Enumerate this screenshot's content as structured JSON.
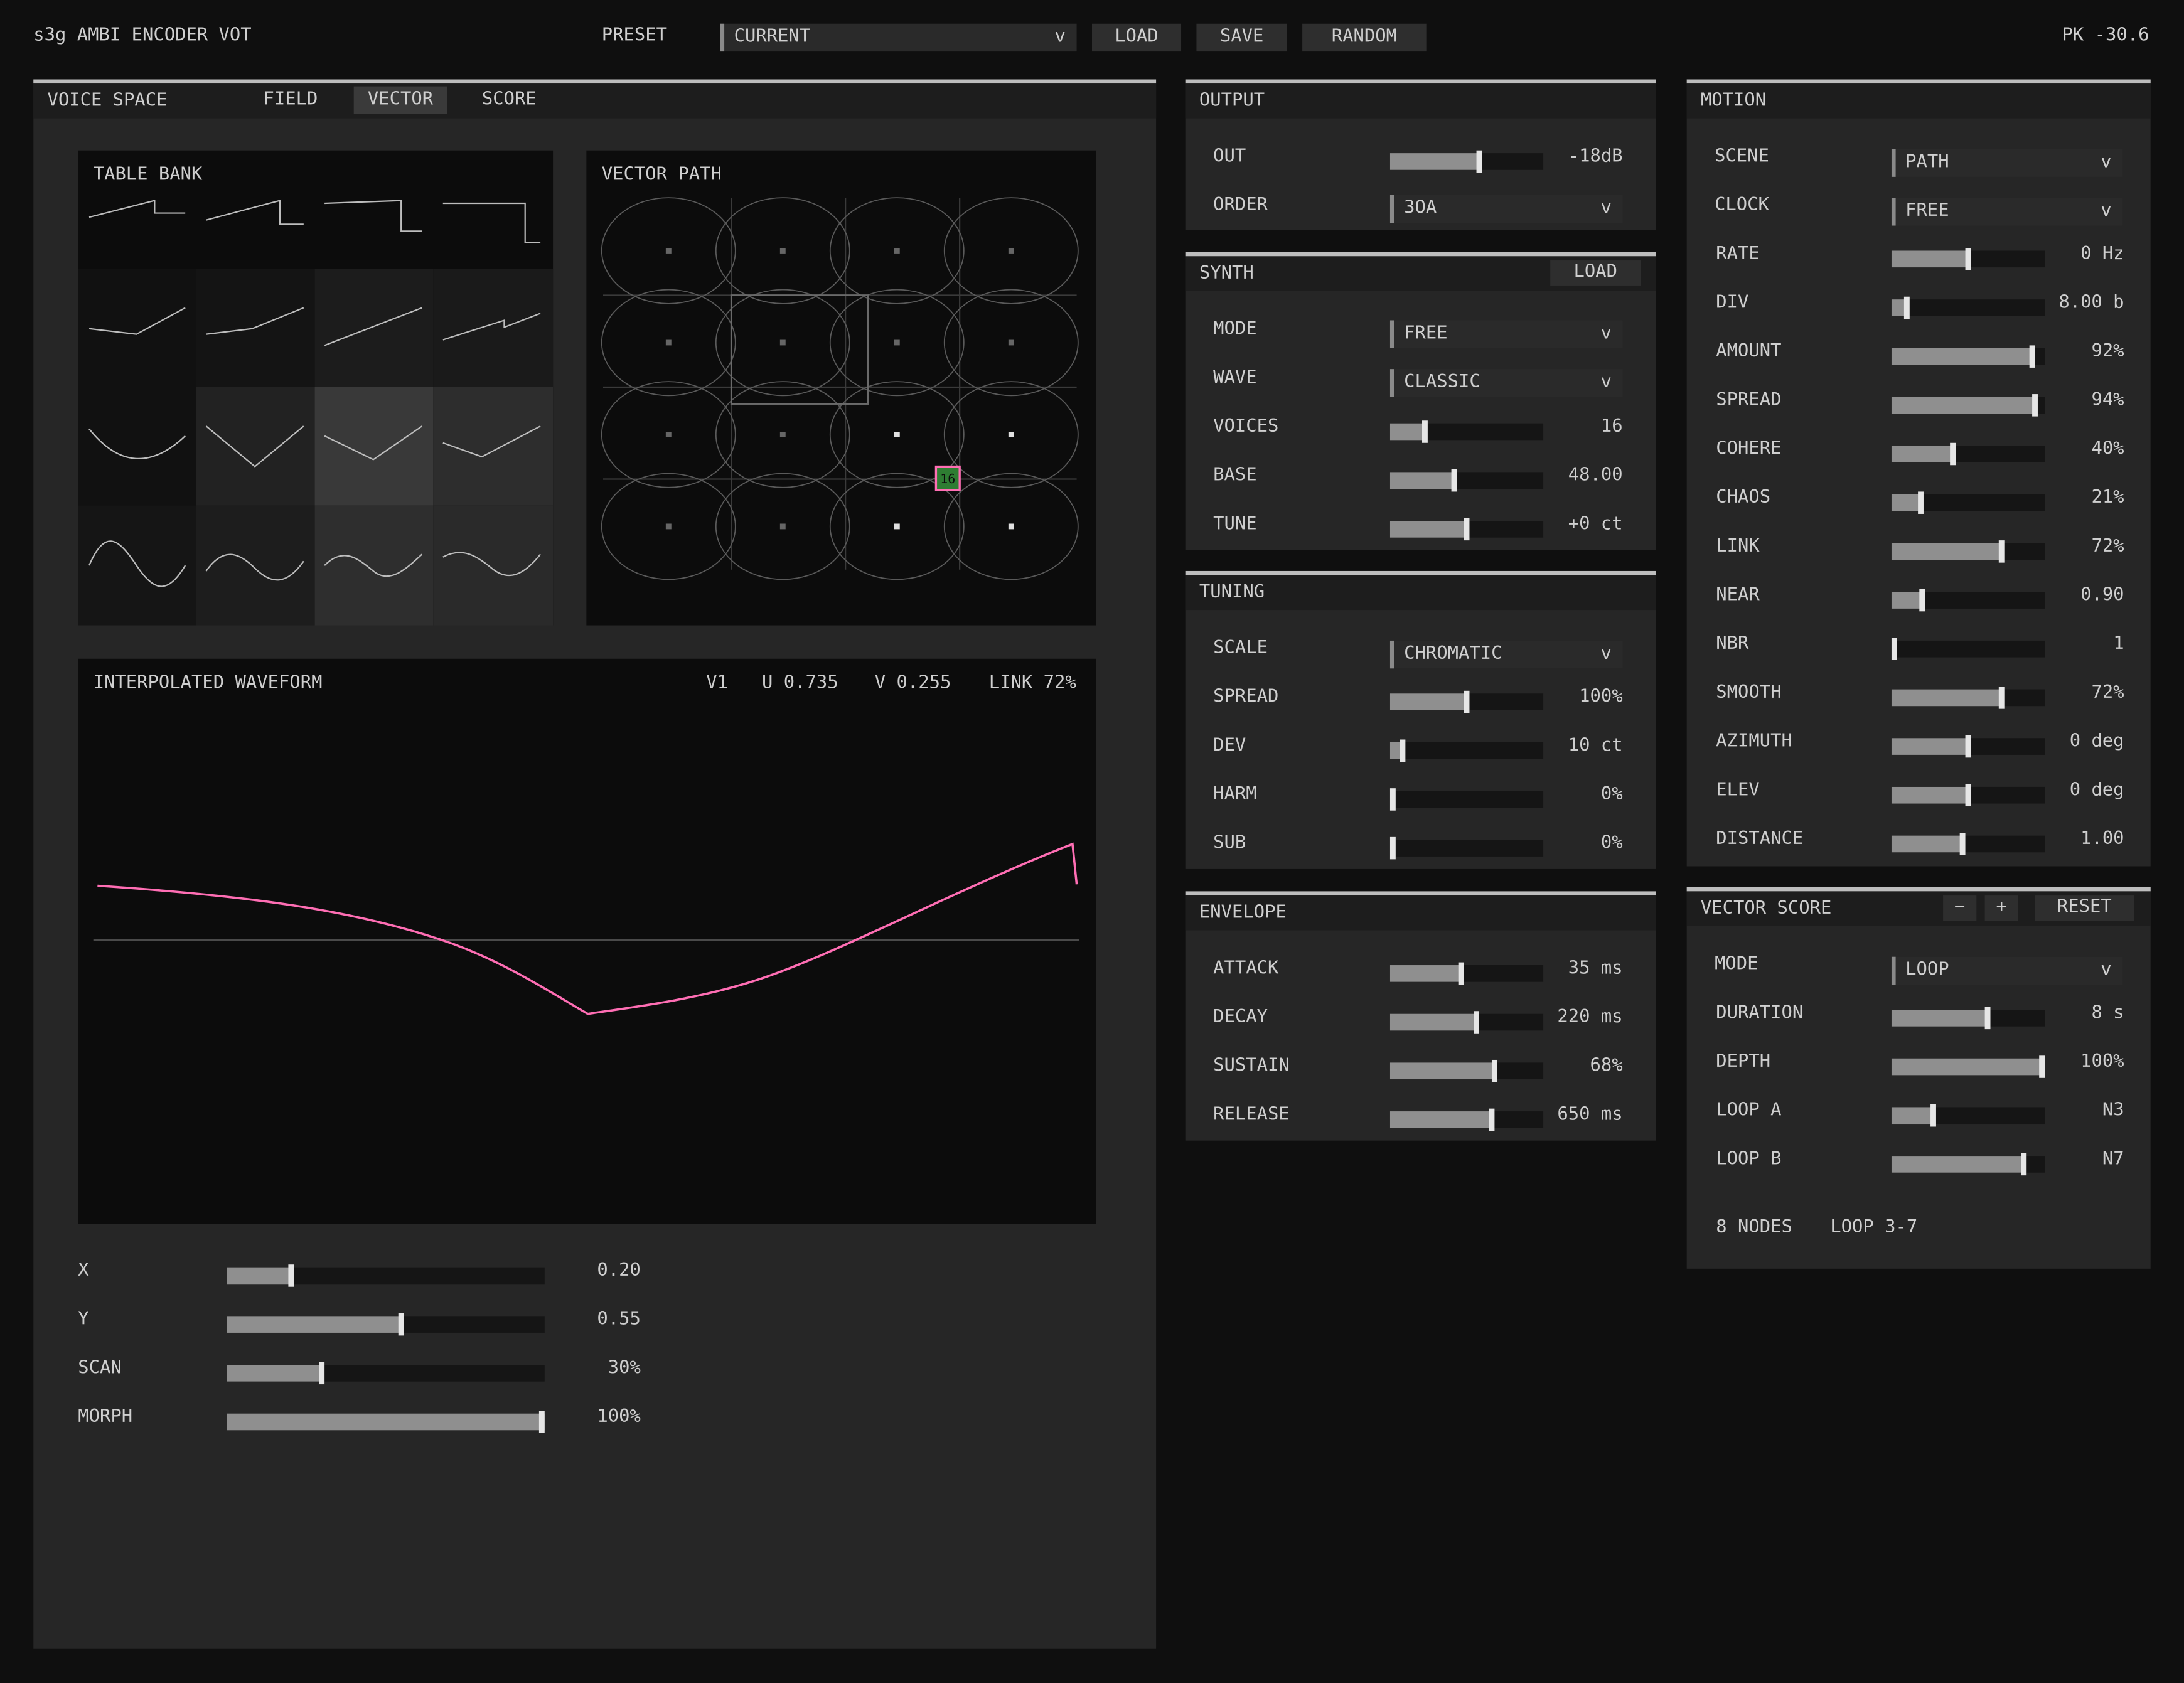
{
  "app": {
    "title": "s3g AMBI ENCODER VOT",
    "peak": "PK -30.6"
  },
  "preset": {
    "label": "PRESET",
    "value": "CURRENT",
    "chevron": "v",
    "load": "LOAD",
    "save": "SAVE",
    "random": "RANDOM"
  },
  "voice_space": {
    "title": "VOICE SPACE",
    "tabs": [
      {
        "label": "FIELD",
        "active": false
      },
      {
        "label": "VECTOR",
        "active": true
      },
      {
        "label": "SCORE",
        "active": false
      }
    ],
    "table_bank": {
      "title": "TABLE BANK"
    },
    "vector_path": {
      "title": "VECTOR PATH",
      "node_label": "16"
    },
    "waveform": {
      "title": "INTERPOLATED WAVEFORM",
      "voice": "V1",
      "u": "U 0.735",
      "v": "V 0.255",
      "link": "LINK 72%"
    },
    "sliders": [
      {
        "label": "X",
        "value": "0.20",
        "level": 0.2
      },
      {
        "label": "Y",
        "value": "0.55",
        "level": 0.55
      },
      {
        "label": "SCAN",
        "value": "30%",
        "level": 0.3
      },
      {
        "label": "MORPH",
        "value": "100%",
        "level": 1.0
      }
    ]
  },
  "output": {
    "title": "OUTPUT",
    "out": {
      "label": "OUT",
      "value": "-18dB",
      "level": 0.58
    },
    "order": {
      "label": "ORDER",
      "value": "3OA",
      "chevron": "v"
    }
  },
  "synth": {
    "title": "SYNTH",
    "load": "LOAD",
    "mode": {
      "label": "MODE",
      "value": "FREE",
      "chevron": "v"
    },
    "wave": {
      "label": "WAVE",
      "value": "CLASSIC",
      "chevron": "v"
    },
    "sliders": [
      {
        "label": "VOICES",
        "value": "16",
        "level": 0.23
      },
      {
        "label": "BASE",
        "value": "48.00",
        "level": 0.42
      },
      {
        "label": "TUNE",
        "value": "+0 ct",
        "level": 0.5
      }
    ]
  },
  "tuning": {
    "title": "TUNING",
    "scale": {
      "label": "SCALE",
      "value": "CHROMATIC",
      "chevron": "v"
    },
    "sliders": [
      {
        "label": "SPREAD",
        "value": "100%",
        "level": 0.5
      },
      {
        "label": "DEV",
        "value": "10 ct",
        "level": 0.08
      },
      {
        "label": "HARM",
        "value": "0%",
        "level": 0.0
      },
      {
        "label": "SUB",
        "value": "0%",
        "level": 0.0
      }
    ]
  },
  "envelope": {
    "title": "ENVELOPE",
    "sliders": [
      {
        "label": "ATTACK",
        "value": "35 ms",
        "level": 0.46
      },
      {
        "label": "DECAY",
        "value": "220 ms",
        "level": 0.56
      },
      {
        "label": "SUSTAIN",
        "value": "68%",
        "level": 0.68
      },
      {
        "label": "RELEASE",
        "value": "650 ms",
        "level": 0.66
      }
    ]
  },
  "motion": {
    "title": "MOTION",
    "scene": {
      "label": "SCENE",
      "value": "PATH",
      "chevron": "v"
    },
    "clock": {
      "label": "CLOCK",
      "value": "FREE",
      "chevron": "v"
    },
    "sliders": [
      {
        "label": "RATE",
        "value": "0 Hz",
        "level": 0.5
      },
      {
        "label": "DIV",
        "value": "8.00 b",
        "level": 0.1
      },
      {
        "label": "AMOUNT",
        "value": "92%",
        "level": 0.92
      },
      {
        "label": "SPREAD",
        "value": "94%",
        "level": 0.94
      },
      {
        "label": "COHERE",
        "value": "40%",
        "level": 0.4
      },
      {
        "label": "CHAOS",
        "value": "21%",
        "level": 0.19
      },
      {
        "label": "LINK",
        "value": "72%",
        "level": 0.72
      },
      {
        "label": "NEAR",
        "value": "0.90",
        "level": 0.2
      },
      {
        "label": "NBR",
        "value": "1",
        "level": 0.0
      },
      {
        "label": "SMOOTH",
        "value": "72%",
        "level": 0.72
      },
      {
        "label": "AZIMUTH",
        "value": "0 deg",
        "level": 0.5
      },
      {
        "label": "ELEV",
        "value": "0 deg",
        "level": 0.5
      },
      {
        "label": "DISTANCE",
        "value": "1.00",
        "level": 0.46
      }
    ]
  },
  "vector_score": {
    "title": "VECTOR SCORE",
    "minus": "−",
    "plus": "+",
    "reset": "RESET",
    "mode": {
      "label": "MODE",
      "value": "LOOP",
      "chevron": "v"
    },
    "sliders": [
      {
        "label": "DURATION",
        "value": "8 s",
        "level": 0.63
      },
      {
        "label": "DEPTH",
        "value": "100%",
        "level": 0.98
      },
      {
        "label": "LOOP A",
        "value": "N3",
        "level": 0.27
      },
      {
        "label": "LOOP B",
        "value": "N7",
        "level": 0.86
      }
    ],
    "nodes": "8 NODES",
    "loop": "LOOP 3-7"
  },
  "colors": {
    "accent": "#ff6eb4",
    "background": "#0f0f0f",
    "panel": "#262626",
    "node_fill": "#2e7d32"
  }
}
